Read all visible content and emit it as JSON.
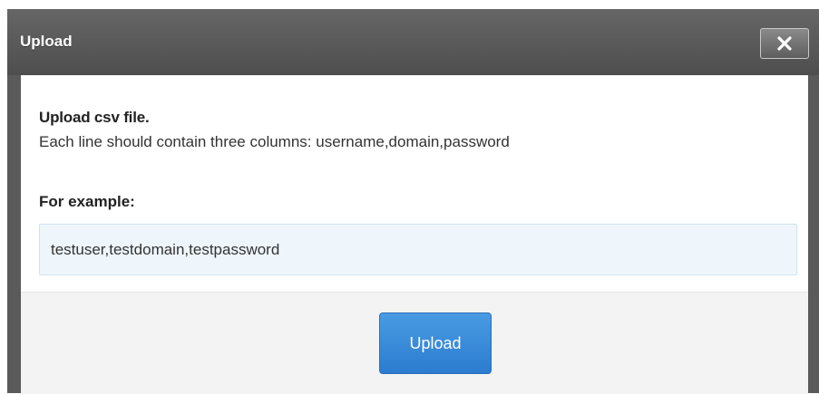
{
  "dialog": {
    "title": "Upload",
    "close_icon": "close-icon"
  },
  "content": {
    "heading": "Upload csv file.",
    "description": "Each line should contain three columns: username,domain,password",
    "example_label": "For example:",
    "example_value": "testuser,testdomain,testpassword"
  },
  "footer": {
    "upload_label": "Upload"
  },
  "colors": {
    "titlebar": "#5a5a5a",
    "accent": "#3a8bdb",
    "example_bg": "#eef6fc"
  }
}
